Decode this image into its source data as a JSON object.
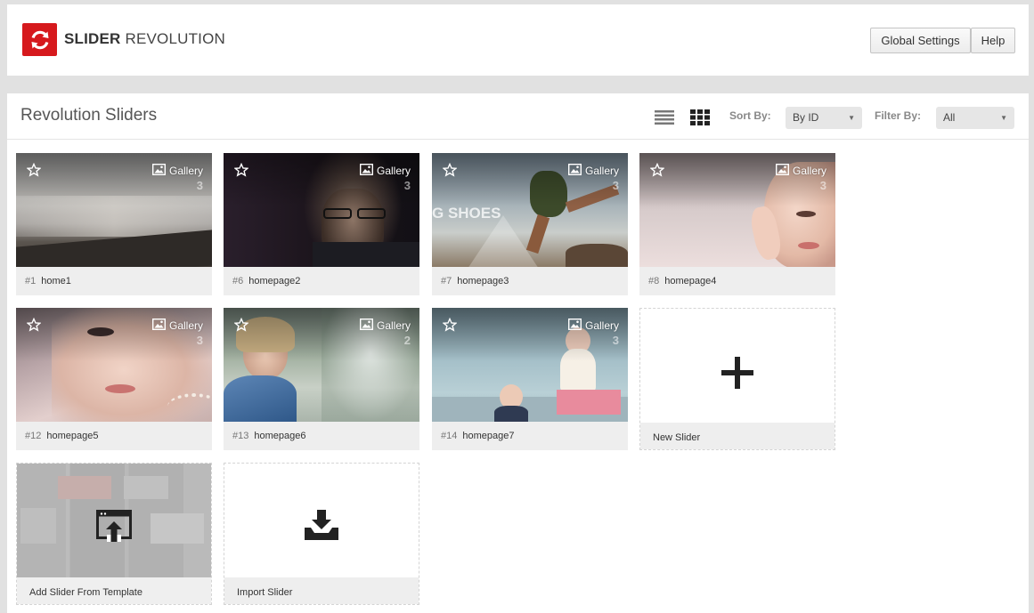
{
  "header": {
    "brand_bold": "SLIDER",
    "brand_light": "REVOLUTION",
    "global_settings_label": "Global Settings",
    "help_label": "Help",
    "logo_icon": "refresh-icon",
    "accent_color": "#d6191d"
  },
  "toolbar": {
    "title": "Revolution Sliders",
    "list_view_icon": "list-view-icon",
    "grid_view_icon": "grid-view-icon",
    "sort_label": "Sort By:",
    "sort_value": "By ID",
    "filter_label": "Filter By:",
    "filter_value": "All"
  },
  "sliders": [
    {
      "id": "#1",
      "name": "home1",
      "type": "Gallery",
      "slides": "3"
    },
    {
      "id": "#6",
      "name": "homepage2",
      "type": "Gallery",
      "slides": "3"
    },
    {
      "id": "#7",
      "name": "homepage3",
      "type": "Gallery",
      "slides": "3",
      "thumb_text": "G SHOES"
    },
    {
      "id": "#8",
      "name": "homepage4",
      "type": "Gallery",
      "slides": "3"
    },
    {
      "id": "#12",
      "name": "homepage5",
      "type": "Gallery",
      "slides": "3"
    },
    {
      "id": "#13",
      "name": "homepage6",
      "type": "Gallery",
      "slides": "2"
    },
    {
      "id": "#14",
      "name": "homepage7",
      "type": "Gallery",
      "slides": "3"
    }
  ],
  "actions": {
    "new_slider": "New Slider",
    "from_template": "Add Slider From Template",
    "import_slider": "Import Slider"
  }
}
